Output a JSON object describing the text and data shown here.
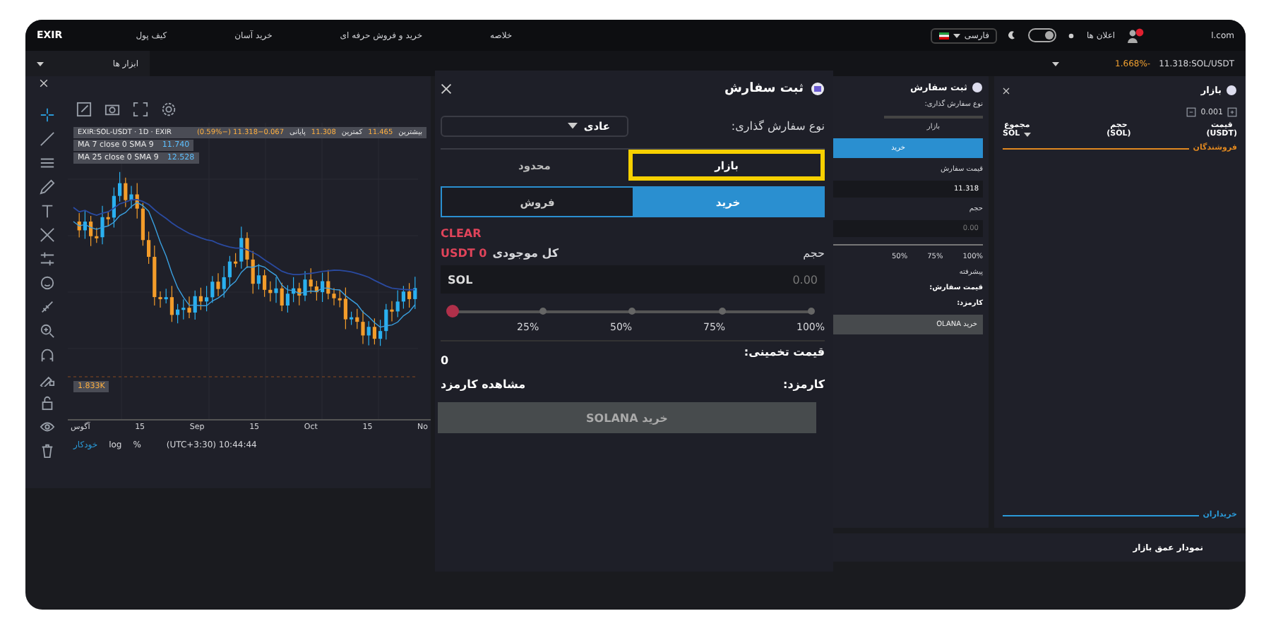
{
  "top_nav": {
    "logo": "EXIR",
    "items": [
      "خلاصه",
      "خرید و فروش حرفه ای",
      "خرید آسان",
      "کیف پول"
    ],
    "language": "فارسی",
    "dark_mode": true,
    "notifications": "اعلان ها",
    "site": "l.com"
  },
  "sub_bar": {
    "tab": "ابزار ها",
    "change": "1.668%-",
    "ticker": "11.318:SOL/USDT"
  },
  "chart": {
    "symbol": "EXIR:SOL-USDT · 1D · EXIR",
    "legend": [
      {
        "label": "بیشترین",
        "value": "11.465"
      },
      {
        "label": "کمترین",
        "value": "11.308"
      },
      {
        "label": "پایانی",
        "value": "11.318−0.067 (−0.59%)"
      }
    ],
    "indicators": [
      {
        "name": "MA 7 close 0 SMA 9",
        "value": "11.740"
      },
      {
        "name": "MA 25 close 0 SMA 9",
        "value": "12.528"
      }
    ],
    "volume": "1.833K",
    "x_labels": [
      "No",
      "15",
      "Oct",
      "15",
      "Sep",
      "15",
      "آگوس"
    ],
    "footer": {
      "auto": "خودکار",
      "log": "log",
      "percent": "%",
      "time": "(UTC+3:30) 10:44:44"
    }
  },
  "order_panel": {
    "title": "ثبت سفارش",
    "order_type_label": "نوع سفارش گذاری:",
    "tab": "بازار",
    "side": "خرید",
    "price_label": "قیمت سفارش",
    "price": "11.318",
    "amount_label": "حجم",
    "amount_placeholder": "0.00",
    "marks": [
      "100%",
      "75%",
      "50%"
    ],
    "advanced": "پیشرفته",
    "price_summary_label": "قیمت سفارش:",
    "fee_label": "کارمزد:",
    "submit": "خرید OLANA"
  },
  "order_book": {
    "title": "بازار",
    "step": "0.001",
    "columns": [
      {
        "label": "قیمت",
        "unit": "(USDT)"
      },
      {
        "label": "حجم",
        "unit": "(SOL)"
      },
      {
        "label": "مجموع",
        "unit": "SOL"
      }
    ],
    "sellers": "فروشندگان",
    "buyers": "خریداران"
  },
  "depth_chart": {
    "title": "نمودار عمق بازار"
  },
  "order_dialog": {
    "title": "ثبت سفارش",
    "order_type_label": "نوع سفارش گذاری:",
    "order_type": "عادی",
    "tabs": [
      {
        "label": "بازار",
        "selected": true,
        "highlighted": true
      },
      {
        "label": "محدود",
        "selected": false,
        "highlighted": false
      }
    ],
    "sides": [
      {
        "label": "خرید",
        "selected": true
      },
      {
        "label": "فروش",
        "selected": false
      }
    ],
    "clear": "CLEAR",
    "amount_label": "حجم",
    "balance_label": "کل موجودی",
    "balance": "USDT 0",
    "amount_placeholder": "0.00",
    "unit": "SOL",
    "slider": {
      "level": 0,
      "marks": [
        "100%",
        "75%",
        "50%",
        "25%"
      ]
    },
    "estimate_label": "قیمت تخمینی:",
    "estimate": "0",
    "fee_label": "کارمزد:",
    "fee_link": "مشاهده کارمزد",
    "submit": {
      "label": "خرید SOLANA",
      "disabled": true
    }
  }
}
